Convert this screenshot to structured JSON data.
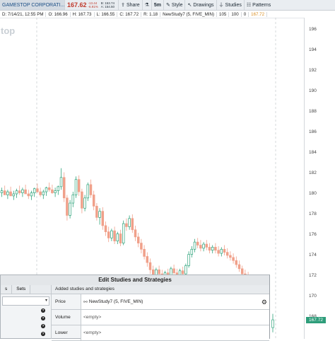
{
  "toolbar": {
    "symbol": "GAMESTOP CORPORATI...",
    "last_price": "167.62",
    "net_change": "-13.44",
    "pct_change": "-6.91%",
    "bid": "B: 153.74",
    "ask": "A: 154.50",
    "share_label": "Share",
    "timeframe_label": "5m",
    "style_label": "Style",
    "drawings_label": "Drawings",
    "studies_label": "Studies",
    "patterns_label": "Patterns"
  },
  "infobar": {
    "date": "D: 7/14/21, 12:55 PM",
    "open": "O: 166.96",
    "high": "H: 167.73",
    "low": "L: 166.55",
    "close": "C: 167.72",
    "range": "R: 1.18",
    "study": "NewStudy7 (5, FIVE_MIN)",
    "v1": "105",
    "v2": "100",
    "v3": "0",
    "v4": "167.72"
  },
  "watermark": "top",
  "price_axis": {
    "labels": [
      "196",
      "194",
      "192",
      "190",
      "188",
      "186",
      "184",
      "182",
      "180",
      "178",
      "176",
      "174",
      "172",
      "170",
      "168"
    ],
    "current_price": "167.72"
  },
  "candles": [
    [
      180.1,
      180.6,
      179.7,
      180.3
    ],
    [
      180.3,
      180.8,
      179.9,
      179.9
    ],
    [
      179.9,
      180.4,
      179.5,
      180.2
    ],
    [
      180.2,
      180.7,
      179.8,
      179.8
    ],
    [
      179.8,
      180.3,
      179.4,
      180.0
    ],
    [
      180.0,
      180.5,
      179.6,
      180.3
    ],
    [
      180.3,
      180.8,
      179.9,
      180.1
    ],
    [
      180.1,
      180.6,
      179.7,
      180.4
    ],
    [
      180.4,
      180.9,
      180.0,
      180.0
    ],
    [
      180.0,
      180.4,
      179.5,
      179.8
    ],
    [
      179.8,
      180.3,
      179.4,
      180.1
    ],
    [
      180.1,
      180.6,
      179.7,
      180.5
    ],
    [
      180.5,
      181.0,
      180.1,
      180.2
    ],
    [
      180.2,
      180.6,
      179.7,
      179.9
    ],
    [
      179.9,
      180.4,
      179.5,
      180.2
    ],
    [
      180.2,
      180.7,
      179.8,
      180.6
    ],
    [
      180.6,
      181.1,
      180.2,
      180.4
    ],
    [
      180.4,
      180.9,
      180.0,
      180.1
    ],
    [
      180.1,
      180.6,
      179.7,
      180.3
    ],
    [
      180.3,
      180.8,
      179.9,
      180.7
    ],
    [
      180.7,
      182.5,
      180.4,
      181.6
    ],
    [
      181.6,
      182.1,
      179.2,
      179.6
    ],
    [
      179.6,
      179.9,
      177.4,
      177.9
    ],
    [
      177.9,
      179.4,
      177.6,
      179.1
    ],
    [
      179.1,
      180.2,
      178.7,
      179.9
    ],
    [
      179.9,
      181.7,
      179.6,
      181.4
    ],
    [
      181.4,
      181.8,
      179.8,
      180.2
    ],
    [
      180.2,
      180.5,
      178.1,
      178.6
    ],
    [
      178.6,
      179.9,
      178.3,
      179.6
    ],
    [
      179.6,
      181.1,
      179.3,
      180.9
    ],
    [
      180.9,
      181.4,
      179.6,
      179.9
    ],
    [
      179.9,
      180.3,
      178.4,
      178.8
    ],
    [
      178.8,
      179.1,
      177.4,
      177.7
    ],
    [
      177.7,
      178.6,
      177.0,
      178.3
    ],
    [
      178.3,
      178.7,
      176.5,
      176.9
    ],
    [
      176.9,
      177.3,
      175.9,
      176.3
    ],
    [
      176.3,
      176.8,
      175.3,
      175.7
    ],
    [
      175.7,
      176.6,
      175.4,
      176.4
    ],
    [
      176.4,
      176.8,
      175.1,
      175.4
    ],
    [
      175.4,
      176.3,
      175.1,
      176.1
    ],
    [
      176.1,
      176.5,
      174.9,
      175.2
    ],
    [
      175.2,
      177.4,
      175.0,
      177.1
    ],
    [
      177.1,
      177.6,
      176.4,
      176.8
    ],
    [
      176.8,
      177.9,
      176.5,
      177.6
    ],
    [
      177.6,
      178.0,
      176.2,
      176.5
    ],
    [
      176.5,
      176.9,
      175.4,
      175.8
    ],
    [
      175.8,
      176.2,
      174.8,
      175.2
    ],
    [
      175.2,
      175.6,
      174.2,
      174.6
    ],
    [
      174.6,
      175.0,
      173.6,
      173.9
    ],
    [
      173.9,
      174.3,
      172.9,
      173.3
    ],
    [
      173.3,
      173.7,
      172.2,
      172.6
    ],
    [
      172.6,
      173.0,
      171.6,
      172.0
    ],
    [
      172.0,
      172.8,
      171.6,
      172.6
    ],
    [
      172.6,
      173.0,
      171.8,
      172.2
    ],
    [
      172.2,
      172.6,
      171.3,
      171.7
    ],
    [
      171.7,
      172.5,
      171.4,
      172.3
    ],
    [
      172.3,
      172.7,
      171.6,
      172.0
    ],
    [
      172.0,
      172.9,
      171.7,
      172.7
    ],
    [
      172.7,
      173.1,
      172.0,
      172.3
    ],
    [
      172.3,
      172.7,
      171.5,
      171.9
    ],
    [
      171.9,
      172.7,
      171.6,
      172.5
    ],
    [
      172.5,
      172.9,
      171.9,
      172.2
    ],
    [
      172.2,
      173.2,
      171.9,
      173.0
    ],
    [
      173.0,
      174.4,
      172.8,
      174.1
    ],
    [
      174.1,
      174.9,
      173.8,
      174.6
    ],
    [
      174.6,
      175.6,
      174.3,
      175.3
    ],
    [
      175.3,
      175.7,
      174.7,
      175.0
    ],
    [
      175.0,
      175.5,
      174.4,
      174.7
    ],
    [
      174.7,
      175.3,
      174.4,
      175.1
    ],
    [
      175.1,
      175.5,
      174.5,
      174.8
    ],
    [
      174.8,
      175.2,
      174.2,
      174.5
    ],
    [
      174.5,
      175.0,
      174.2,
      174.8
    ],
    [
      174.8,
      175.2,
      174.2,
      174.5
    ],
    [
      174.5,
      174.9,
      173.9,
      174.2
    ],
    [
      174.2,
      174.8,
      173.9,
      174.6
    ],
    [
      174.6,
      175.0,
      174.0,
      174.3
    ],
    [
      174.3,
      174.7,
      173.7,
      174.0
    ],
    [
      174.0,
      174.4,
      173.5,
      173.8
    ],
    [
      173.8,
      174.2,
      173.2,
      173.5
    ],
    [
      173.5,
      173.9,
      172.8,
      173.1
    ],
    [
      173.1,
      173.5,
      172.4,
      172.7
    ],
    [
      172.7,
      173.0,
      171.9,
      172.2
    ],
    [
      172.2,
      172.6,
      171.7,
      172.0
    ],
    [
      172.0,
      172.4,
      171.5,
      171.8
    ]
  ],
  "dialog": {
    "title": "Edit Studies and Strategies",
    "left_tabs": [
      "s",
      "Sets"
    ],
    "added_header": "Added studies and strategies",
    "rows": [
      {
        "label": "Price",
        "value": "NewStudy7 (5, FIVE_MIN)"
      },
      {
        "label": "Volume",
        "value": "<empty>"
      },
      {
        "label": "Lower",
        "value": "<empty>"
      }
    ],
    "help_mark": "?"
  }
}
